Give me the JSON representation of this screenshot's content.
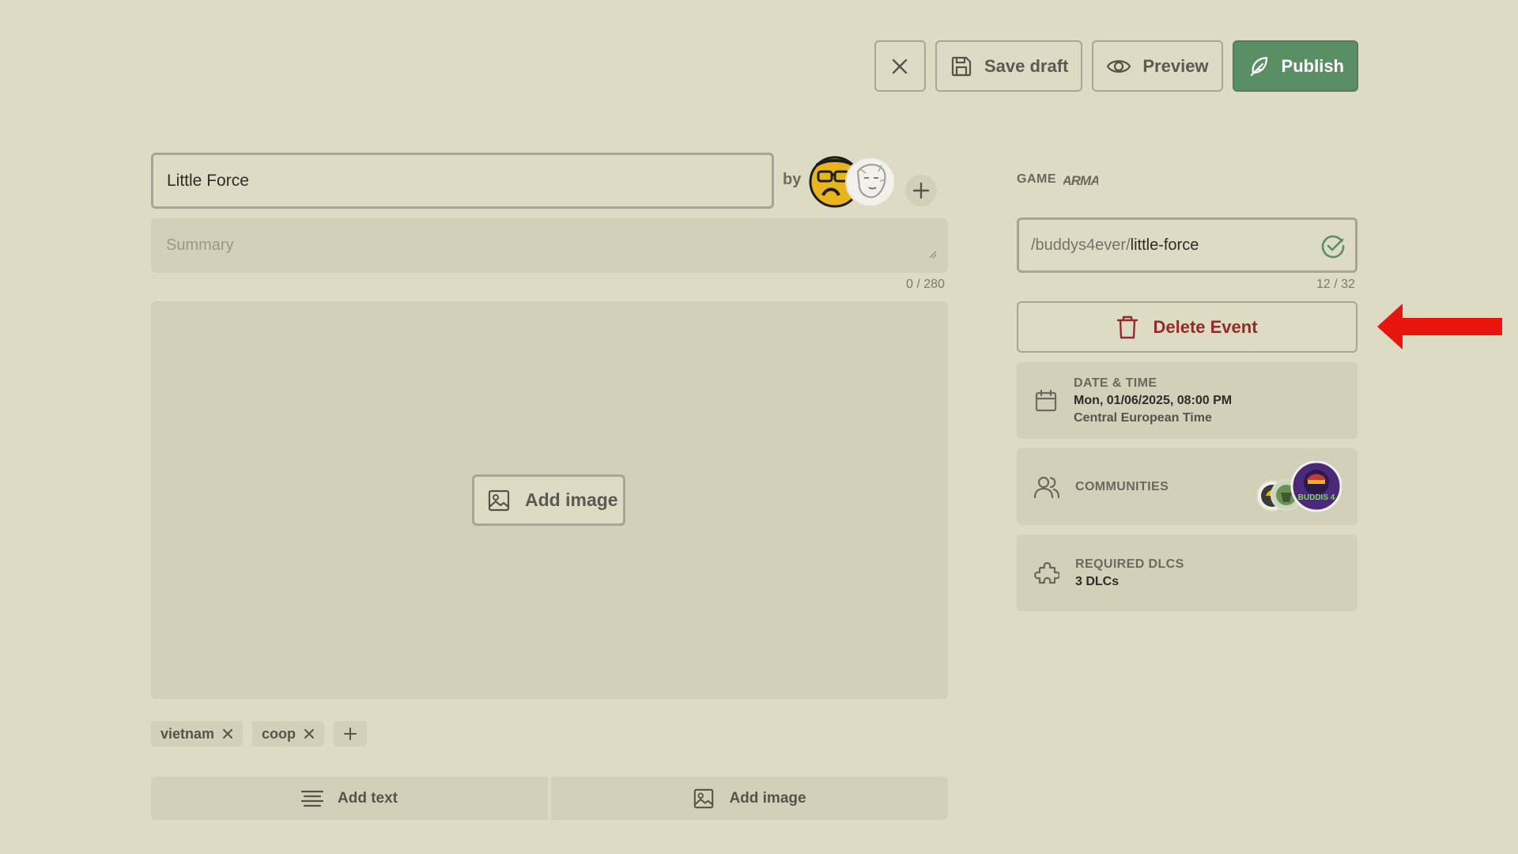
{
  "toolbar": {
    "close_icon": "close-icon",
    "save_draft_label": "Save draft",
    "preview_label": "Preview",
    "publish_label": "Publish"
  },
  "event": {
    "title_value": "Little Force",
    "by_label": "by",
    "summary_placeholder": "Summary",
    "summary_counter": "0 / 280",
    "add_image_label": "Add image"
  },
  "tags": [
    {
      "label": "vietnam"
    },
    {
      "label": "coop"
    }
  ],
  "bottom_bar": {
    "add_text_label": "Add text",
    "add_image_label": "Add image"
  },
  "sidebar": {
    "game_label": "GAME",
    "game_logo_text": "ARMA",
    "slug_prefix": "/buddys4ever/",
    "slug_value": "little-force",
    "slug_counter": "12 / 32",
    "delete_label": "Delete Event",
    "datetime": {
      "label": "DATE & TIME",
      "value": "Mon, 01/06/2025, 08:00 PM",
      "timezone": "Central European Time"
    },
    "communities": {
      "label": "COMMUNITIES",
      "badge_text": "BUDDIS 4"
    },
    "dlcs": {
      "label": "REQUIRED DLCS",
      "value": "3 DLCs"
    }
  },
  "colors": {
    "background": "#dedbc5",
    "panel": "#d3d0ba",
    "publish_green": "#5a8f63",
    "delete_red": "#922b2b",
    "annotation_arrow": "#e8140e"
  }
}
